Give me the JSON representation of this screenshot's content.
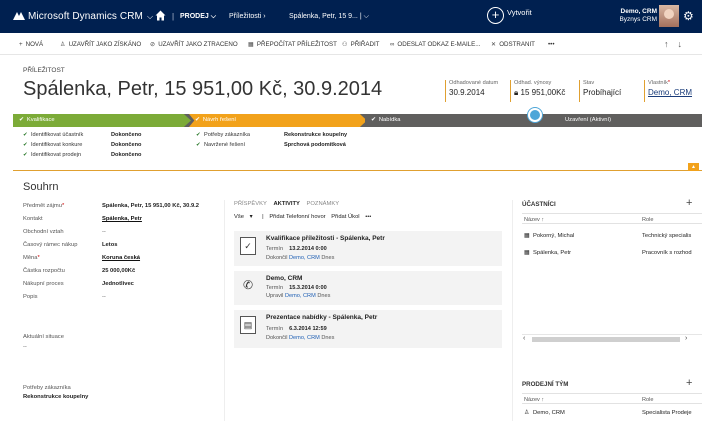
{
  "nav": {
    "app_title": "Microsoft Dynamics CRM",
    "area": "PRODEJ",
    "entity": "Příležitosti",
    "record": "Spálenka, Petr, 15 9...",
    "create_label": "Vytvořit",
    "user_name": "Demo, CRM",
    "user_org": "Byznys CRM"
  },
  "commands": {
    "new": "NOVÁ",
    "close_won": "UZAVŘÍT JAKO ZÍSKÁNO",
    "close_lost": "UZAVŘÍT JAKO ZTRACENO",
    "recalc": "PŘEPOČÍTAT PŘÍLEŽITOST",
    "assign": "PŘIŘADIT",
    "email_link": "ODESLAT ODKAZ E-MAILE...",
    "delete": "ODSTRANIT",
    "more": "•••"
  },
  "header": {
    "entity_type": "PŘÍLEŽITOST",
    "title": "Spálenka, Petr, 15 951,00 Kč, 30.9.2014",
    "fields": [
      {
        "label": "Odhadované datum",
        "value": "30.9.2014"
      },
      {
        "label": "Odhad. výnosy",
        "value": "15 951,00Kč"
      },
      {
        "label": "Stav",
        "value": "Probíhající"
      },
      {
        "label": "Vlastník",
        "value": "Demo, CRM"
      }
    ]
  },
  "process": {
    "stages": [
      "Kvalifikace",
      "Návrh řešení",
      "Nabídka",
      "Uzavření (Aktivní)"
    ],
    "steps_left": [
      {
        "label": "Identifikovat účastník",
        "value": "Dokončeno"
      },
      {
        "label": "Identifikovat konkure",
        "value": "Dokončeno"
      },
      {
        "label": "Identifikovat prodejn",
        "value": "Dokončeno"
      }
    ],
    "steps_mid": [
      {
        "label": "Potřeby zákazníka",
        "value": "Rekonstrukce koupelny"
      },
      {
        "label": "Navržené řešení",
        "value": "Sprchová podomítková"
      }
    ]
  },
  "summary": {
    "title": "Souhrn",
    "fields": [
      {
        "label": "Předmět zájmu",
        "value": "Spálenka, Petr, 15 951,00 Kč, 30.9.2"
      },
      {
        "label": "Kontakt",
        "value": "Spálenka, Petr"
      },
      {
        "label": "Obchodní vztah",
        "value": "--"
      },
      {
        "label": "Časový rámec nákup",
        "value": "Letos"
      },
      {
        "label": "Měna",
        "value": "Koruna česká"
      },
      {
        "label": "Částka rozpočtu",
        "value": "25 000,00Kč"
      },
      {
        "label": "Nákupní proces",
        "value": "Jednotlivec"
      },
      {
        "label": "Popis",
        "value": "--"
      }
    ],
    "situation_label": "Aktuální situace",
    "situation_value": "--",
    "needs_label": "Potřeby zákazníka",
    "needs_value": "Rekonstrukce koupelny"
  },
  "activities": {
    "tabs": [
      "PŘÍSPĚVKY",
      "AKTIVITY",
      "POZNÁMKY"
    ],
    "filter": "Vše",
    "add_call": "Přidat Telefonní hovor",
    "add_task": "Přidat Úkol",
    "more": "•••",
    "items": [
      {
        "title": "Kvalifikace příležitosti - Spálenka, Petr",
        "term_label": "Termín",
        "term": "13.2.2014 0:00",
        "status": "Dokončil",
        "by": "Demo, CRM",
        "when": "Dnes"
      },
      {
        "title": "Demo, CRM",
        "term_label": "Termín",
        "term": "15.3.2014 0:00",
        "status": "Upravil",
        "by": "Demo, CRM",
        "when": "Dnes"
      },
      {
        "title": "Prezentace nabídky - Spálenka, Petr",
        "term_label": "Termín",
        "term": "6.3.2014 12:59",
        "status": "Dokončil",
        "by": "Demo, CRM",
        "when": "Dnes"
      }
    ]
  },
  "stakeholders": {
    "title": "ÚČASTNÍCI",
    "col_name": "Název ↑",
    "col_role": "Role",
    "rows": [
      {
        "name": "Pokorný, Michal",
        "role": "Technický specialis"
      },
      {
        "name": "Spálenka, Petr",
        "role": "Pracovník s rozhod"
      }
    ]
  },
  "salesteam": {
    "title": "PRODEJNÍ TÝM",
    "col_name": "Název ↑",
    "col_role": "Role",
    "rows": [
      {
        "name": "Demo, CRM",
        "role": "Specialista Prodeje"
      }
    ]
  },
  "colors": {
    "nav": "#002050",
    "stage_done": "#7cab38",
    "stage_active": "#f2a21b",
    "stage_todo": "#605f5e"
  }
}
